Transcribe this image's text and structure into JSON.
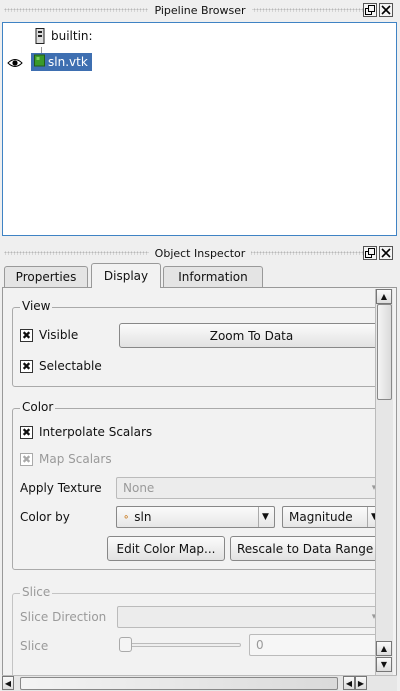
{
  "pipeline_browser": {
    "title": "Pipeline Browser",
    "items": [
      {
        "label": "builtin:",
        "icon": "server-icon"
      },
      {
        "label": "sln.vtk",
        "icon": "dataset-icon",
        "visible": true,
        "selected": true
      }
    ]
  },
  "object_inspector": {
    "title": "Object Inspector",
    "tabs": [
      {
        "label": "Properties"
      },
      {
        "label": "Display",
        "active": true
      },
      {
        "label": "Information"
      }
    ],
    "view_group": {
      "title": "View",
      "visible_label": "Visible",
      "visible_checked": true,
      "selectable_label": "Selectable",
      "selectable_checked": true,
      "zoom_button": "Zoom To Data"
    },
    "color_group": {
      "title": "Color",
      "interpolate_label": "Interpolate Scalars",
      "interpolate_checked": true,
      "map_scalars_label": "Map Scalars",
      "map_scalars_checked": true,
      "apply_texture_label": "Apply Texture",
      "apply_texture_value": "None",
      "color_by_label": "Color by",
      "color_by_value": "sln",
      "component_value": "Magnitude",
      "edit_color_map_button": "Edit Color Map...",
      "rescale_button": "Rescale to Data Range"
    },
    "slice_group": {
      "title": "Slice",
      "slice_direction_label": "Slice Direction",
      "slice_direction_value": "",
      "slice_label": "Slice",
      "slice_value": "0"
    }
  },
  "colors": {
    "selection": "#3e6fb1",
    "panel_border": "#3f83c4",
    "dataset_green": "#3a9a2a"
  }
}
